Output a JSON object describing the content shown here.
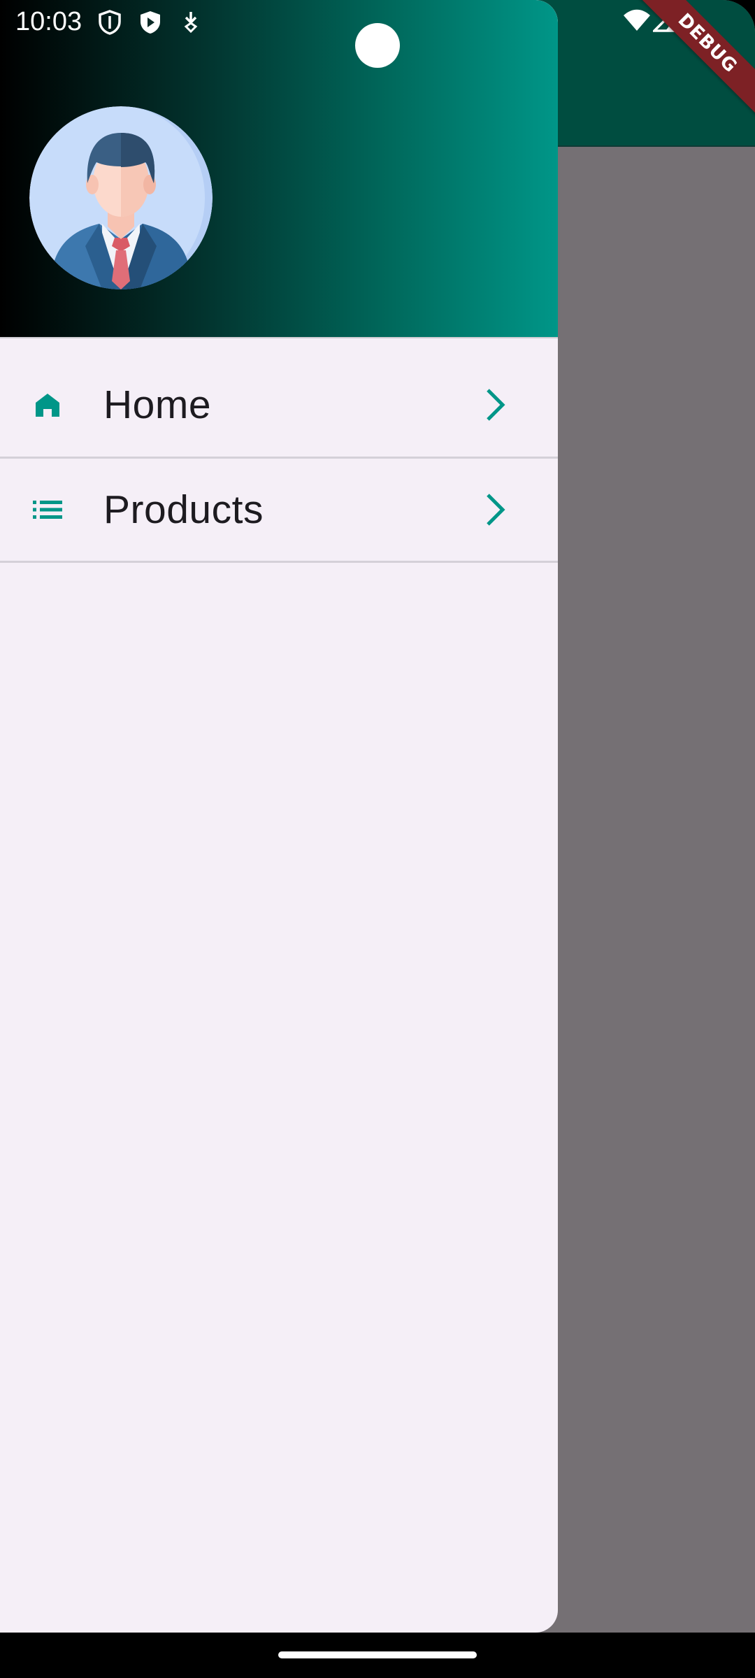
{
  "status_bar": {
    "time": "10:03",
    "left_icons": [
      "shield-outline-icon",
      "play-shield-icon",
      "download-icon"
    ],
    "right_icons": [
      "wifi-icon",
      "signal-icon"
    ]
  },
  "debug_banner": {
    "label": "DEBUG"
  },
  "drawer": {
    "header": {
      "avatar": "user-businessman-avatar",
      "gradient_colors": [
        "#000000",
        "#009688"
      ]
    },
    "items": [
      {
        "label": "Home",
        "icon": "home-icon",
        "trailing_icon": "chevron-right-icon"
      },
      {
        "label": "Products",
        "icon": "list-icon",
        "trailing_icon": "chevron-right-icon"
      }
    ]
  },
  "colors": {
    "accent": "#009688",
    "app_bar": "#004d40",
    "drawer_bg": "#f5eff7",
    "scrim": "#757074",
    "debug_banner": "#7d2125"
  }
}
